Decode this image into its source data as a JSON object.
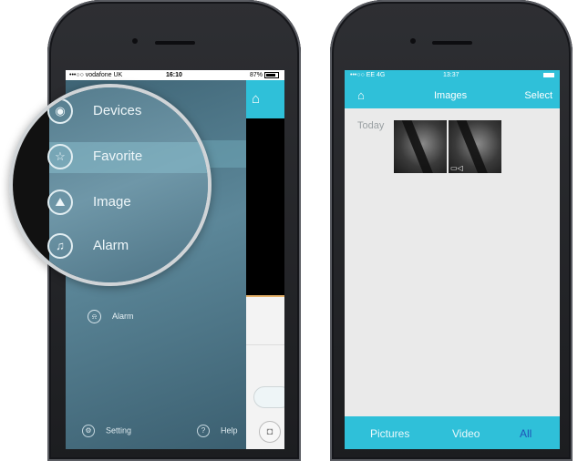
{
  "left_phone": {
    "status_bar": {
      "carrier": "•••○○ vodafone UK",
      "time": "16:10",
      "battery": "87%"
    },
    "drawer": {
      "items": [
        {
          "label": "Devices",
          "icon": "camera-icon"
        },
        {
          "label": "Favorite",
          "icon": "star-icon"
        },
        {
          "label": "Image",
          "icon": "image-icon"
        },
        {
          "label": "Alarm",
          "icon": "bell-icon"
        }
      ],
      "small_alarm_label": "Alarm",
      "footer": {
        "setting": "Setting",
        "help": "Help"
      }
    }
  },
  "right_phone": {
    "status_bar": {
      "carrier": "•••○○ EE  4G",
      "time": "13:37"
    },
    "header": {
      "title": "Images",
      "select": "Select"
    },
    "section_label": "Today",
    "tabs": [
      "Pictures",
      "Video",
      "All"
    ],
    "active_tab": "All",
    "accent_color": "#2fc0d9"
  }
}
